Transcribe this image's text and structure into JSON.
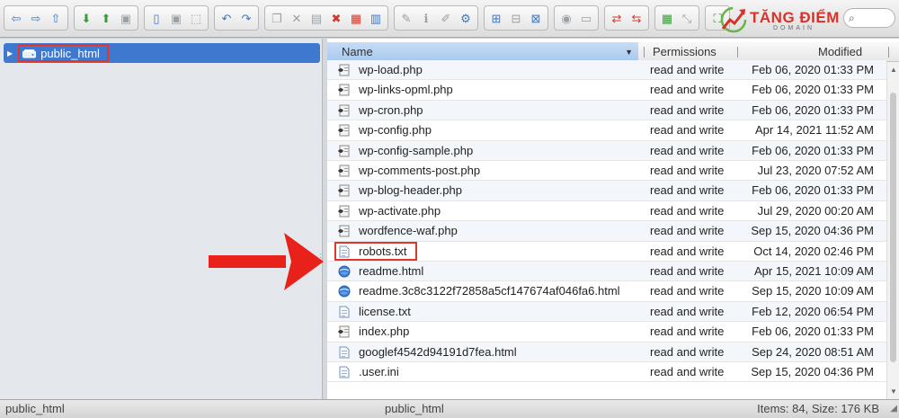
{
  "toolbar": {
    "groups": [
      [
        "back-icon",
        "forward-icon",
        "up-icon"
      ],
      [
        "download-icon",
        "upload-icon",
        "save-icon"
      ],
      [
        "view-icon",
        "save-as-icon",
        "select-icon"
      ],
      [
        "undo-icon",
        "redo-icon"
      ],
      [
        "copy-icon",
        "cut-icon",
        "paste-icon",
        "delete-icon",
        "archive-icon",
        "compress-icon"
      ],
      [
        "edit-icon",
        "info-icon",
        "rename-icon",
        "permissions-icon"
      ],
      [
        "icon-view-icon",
        "list-view-icon",
        "tree-view-icon"
      ],
      [
        "preview-icon",
        "open-icon"
      ],
      [
        "move-icon",
        "extract-icon"
      ],
      [
        "grid-icon",
        "resize-icon"
      ],
      [
        "fullscreen-icon"
      ]
    ]
  },
  "logo": {
    "title": "TĂNG ĐIỂM",
    "subtitle": "DOMAIN"
  },
  "search": {
    "icon": "search-icon"
  },
  "tree": {
    "root_label": "public_html"
  },
  "columns": {
    "name": "Name",
    "permissions": "Permissions",
    "modified": "Modified"
  },
  "files": [
    {
      "name": "wp-load.php",
      "icon": "php-icon",
      "permissions": "read and write",
      "modified": "Feb 06, 2020 01:33 PM"
    },
    {
      "name": "wp-links-opml.php",
      "icon": "php-icon",
      "permissions": "read and write",
      "modified": "Feb 06, 2020 01:33 PM"
    },
    {
      "name": "wp-cron.php",
      "icon": "php-icon",
      "permissions": "read and write",
      "modified": "Feb 06, 2020 01:33 PM"
    },
    {
      "name": "wp-config.php",
      "icon": "php-icon",
      "permissions": "read and write",
      "modified": "Apr 14, 2021 11:52 AM"
    },
    {
      "name": "wp-config-sample.php",
      "icon": "php-icon",
      "permissions": "read and write",
      "modified": "Feb 06, 2020 01:33 PM"
    },
    {
      "name": "wp-comments-post.php",
      "icon": "php-icon",
      "permissions": "read and write",
      "modified": "Jul 23, 2020 07:52 AM"
    },
    {
      "name": "wp-blog-header.php",
      "icon": "php-icon",
      "permissions": "read and write",
      "modified": "Feb 06, 2020 01:33 PM"
    },
    {
      "name": "wp-activate.php",
      "icon": "php-icon",
      "permissions": "read and write",
      "modified": "Jul 29, 2020 00:20 AM"
    },
    {
      "name": "wordfence-waf.php",
      "icon": "php-icon",
      "permissions": "read and write",
      "modified": "Sep 15, 2020 04:36 PM"
    },
    {
      "name": "robots.txt",
      "icon": "text-file-icon",
      "permissions": "read and write",
      "modified": "Oct 14, 2020 02:46 PM",
      "highlighted": true
    },
    {
      "name": "readme.html",
      "icon": "html-globe-icon",
      "permissions": "read and write",
      "modified": "Apr 15, 2021 10:09 AM"
    },
    {
      "name": "readme.3c8c3122f72858a5cf147674af046fa6.html",
      "icon": "html-globe-icon",
      "permissions": "read and write",
      "modified": "Sep 15, 2020 10:09 AM"
    },
    {
      "name": "license.txt",
      "icon": "text-file-icon",
      "permissions": "read and write",
      "modified": "Feb 12, 2020 06:54 PM"
    },
    {
      "name": "index.php",
      "icon": "php-icon",
      "permissions": "read and write",
      "modified": "Feb 06, 2020 01:33 PM"
    },
    {
      "name": "googlef4542d94191d7fea.html",
      "icon": "text-file-icon",
      "permissions": "read and write",
      "modified": "Sep 24, 2020 08:51 AM"
    },
    {
      "name": ".user.ini",
      "icon": "text-file-icon",
      "permissions": "read and write",
      "modified": "Sep 15, 2020 04:36 PM"
    }
  ],
  "status": {
    "left": "public_html",
    "middle": "public_html",
    "right": "Items: 84, Size: 176 KB"
  },
  "colors": {
    "accent": "#3f79cf",
    "highlight": "#e0362c",
    "arrow": "#e8221b"
  }
}
